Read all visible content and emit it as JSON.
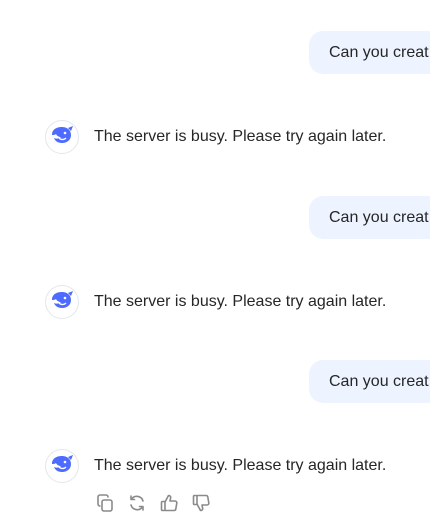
{
  "messages": [
    {
      "role": "user",
      "text": "Can you creat"
    },
    {
      "role": "assistant",
      "text": "The server is busy. Please try again later."
    },
    {
      "role": "user",
      "text": "Can you creat"
    },
    {
      "role": "assistant",
      "text": "The server is busy. Please try again later."
    },
    {
      "role": "user",
      "text": "Can you creat"
    },
    {
      "role": "assistant",
      "text": "The server is busy. Please try again later."
    }
  ],
  "assistant_avatar_icon": "whale-logo-icon",
  "action_icons": [
    "copy-icon",
    "regenerate-icon",
    "thumbs-up-icon",
    "thumbs-down-icon"
  ],
  "colors": {
    "user_bubble": "#eef4ff",
    "brand": "#4d6bfe",
    "text": "#262626",
    "action_icon": "#8a8a8a"
  }
}
